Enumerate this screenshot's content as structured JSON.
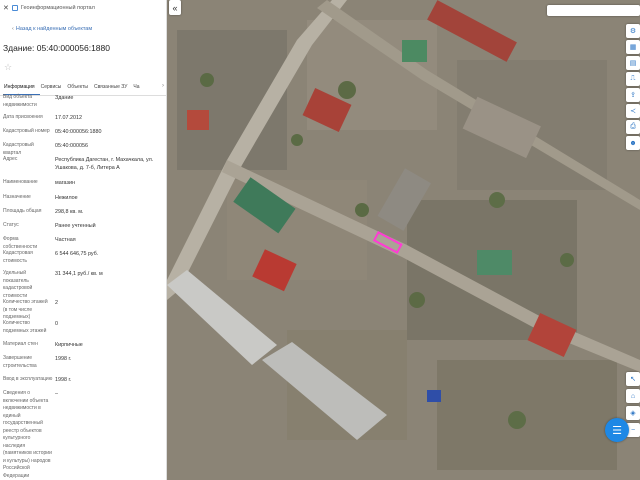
{
  "app": {
    "close_icon": "close-icon",
    "portal_title": "Геоинформационный портал"
  },
  "nav": {
    "back_label": "Назад к найденным объектам"
  },
  "object": {
    "title": "Здание: 05:40:000056:1880"
  },
  "tabs": [
    {
      "label": "Информация",
      "active": true
    },
    {
      "label": "Сервисы",
      "active": false
    },
    {
      "label": "Объекты",
      "active": false
    },
    {
      "label": "Связанные ЗУ",
      "active": false
    },
    {
      "label": "Ча",
      "active": false
    }
  ],
  "attributes": [
    {
      "label": "Вид объекта недвижимости",
      "value": "Здание"
    },
    {
      "label": "Дата присвоения",
      "value": "17.07.2012"
    },
    {
      "label": "Кадастровый номер",
      "value": "05:40:000056:1880"
    },
    {
      "label": "Кадастровый квартал",
      "value": "05:40:000056"
    },
    {
      "label": "Адрес",
      "value": "Республика Дагестан, г. Махачкала, ул. Ушакова, д. 7-б, Литера А"
    },
    {
      "label": "Наименование",
      "value": "магазин"
    },
    {
      "label": "Назначение",
      "value": "Нежилое"
    },
    {
      "label": "Площадь общая",
      "value": "298,8 кв. м."
    },
    {
      "label": "Статус",
      "value": "Ранее учтенный"
    },
    {
      "label": "Форма собственности",
      "value": "Частная"
    },
    {
      "label": "Кадастровая стоимость",
      "value": "6 544 646,75 руб."
    },
    {
      "label": "Удельный показатель кадастровой стоимости",
      "value": "31 344,1 руб./ кв. м"
    },
    {
      "label": "Количество этажей (в том числе подземных)",
      "value": "2"
    },
    {
      "label": "Количество подземных этажей",
      "value": "0"
    },
    {
      "label": "Материал стен",
      "value": "Кирпичные"
    },
    {
      "label": "Завершение строительства",
      "value": "1998 г."
    },
    {
      "label": "Ввод в эксплуатацию",
      "value": "1998 г."
    },
    {
      "label": "Сведения о включении объекта недвижимости в единый государственный реестр объектов культурного наследия (памятников истории и культуры) народов Российской Федерации",
      "value": "–"
    }
  ],
  "map": {
    "search_placeholder": "",
    "scale_label": "",
    "highlight_color": "#ff3bd4",
    "tools": [
      "layers-icon",
      "info-icon",
      "measure-icon",
      "ruler-icon",
      "export-icon",
      "share-icon",
      "print-icon",
      "user-icon"
    ],
    "bottom_tools": [
      "cursor-icon",
      "home-icon",
      "compass-icon",
      "zoom-out-icon"
    ]
  }
}
